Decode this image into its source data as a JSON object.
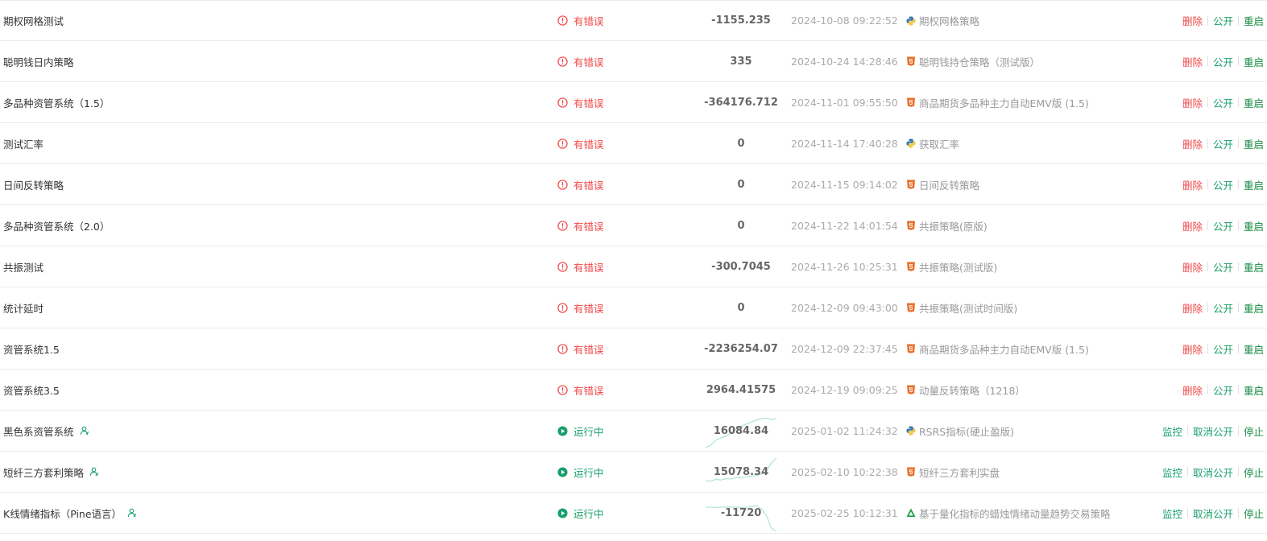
{
  "actions_error": {
    "delete": "删除",
    "publish": "公开",
    "restart": "重启"
  },
  "actions_running": {
    "monitor": "监控",
    "unpublish": "取消公开",
    "stop": "停止"
  },
  "colors": {
    "error": "#f04848",
    "running": "#1aa06c",
    "sparkline": "#9fe0c5"
  },
  "rows": [
    {
      "name": "期权网格测试",
      "status": "有错误",
      "status_type": "error",
      "profit": "-1155.235",
      "time": "2024-10-08 09:22:52",
      "lang": "python-icon",
      "strategy": "期权网格策略",
      "shared": false
    },
    {
      "name": "聪明钱日内策略",
      "status": "有错误",
      "status_type": "error",
      "profit": "335",
      "time": "2024-10-24 14:28:46",
      "lang": "javascript-icon",
      "strategy": "聪明钱持仓策略（测试版）",
      "shared": false
    },
    {
      "name": "多品种资管系统（1.5）",
      "status": "有错误",
      "status_type": "error",
      "profit": "-364176.712",
      "time": "2024-11-01 09:55:50",
      "lang": "javascript-icon",
      "strategy": "商品期货多品种主力自动EMV版 (1.5)",
      "shared": false
    },
    {
      "name": "测试汇率",
      "status": "有错误",
      "status_type": "error",
      "profit": "0",
      "time": "2024-11-14 17:40:28",
      "lang": "python-icon",
      "strategy": "获取汇率",
      "shared": false
    },
    {
      "name": "日间反转策略",
      "status": "有错误",
      "status_type": "error",
      "profit": "0",
      "time": "2024-11-15 09:14:02",
      "lang": "javascript-icon",
      "strategy": "日间反转策略",
      "shared": false
    },
    {
      "name": "多品种资管系统（2.0）",
      "status": "有错误",
      "status_type": "error",
      "profit": "0",
      "time": "2024-11-22 14:01:54",
      "lang": "javascript-icon",
      "strategy": "共振策略(原版)",
      "shared": false
    },
    {
      "name": "共振测试",
      "status": "有错误",
      "status_type": "error",
      "profit": "-300.7045",
      "time": "2024-11-26 10:25:31",
      "lang": "javascript-icon",
      "strategy": "共振策略(测试版)",
      "shared": false
    },
    {
      "name": "统计延时",
      "status": "有错误",
      "status_type": "error",
      "profit": "0",
      "time": "2024-12-09 09:43:00",
      "lang": "javascript-icon",
      "strategy": "共振策略(测试时间版)",
      "shared": false
    },
    {
      "name": "资管系统1.5",
      "status": "有错误",
      "status_type": "error",
      "profit": "-2236254.07",
      "time": "2024-12-09 22:37:45",
      "lang": "javascript-icon",
      "strategy": "商品期货多品种主力自动EMV版 (1.5)",
      "shared": false
    },
    {
      "name": "资管系统3.5",
      "status": "有错误",
      "status_type": "error",
      "profit": "2964.41575",
      "time": "2024-12-19 09:09:25",
      "lang": "javascript-icon",
      "strategy": "动量反转策略（1218）",
      "shared": false
    },
    {
      "name": "黑色系资管系统",
      "status": "运行中",
      "status_type": "running",
      "profit": "16084.84",
      "time": "2025-01-02 11:24:32",
      "lang": "python-icon",
      "strategy": "RSRS指标(硬止盈版)",
      "shared": true,
      "spark": [
        0.05,
        0.12,
        0.28,
        0.35,
        0.4,
        0.5,
        0.62,
        0.7,
        0.78,
        0.84,
        0.9,
        0.95,
        0.97,
        0.92,
        0.96
      ]
    },
    {
      "name": "短纤三方套利策略",
      "status": "运行中",
      "status_type": "running",
      "profit": "15078.34",
      "time": "2025-02-10 10:22:38",
      "lang": "javascript-icon",
      "strategy": "短纤三方套利实盘",
      "shared": true,
      "spark": [
        0.3,
        0.28,
        0.34,
        0.32,
        0.36,
        0.35,
        0.4,
        0.38,
        0.42,
        0.44,
        0.46,
        0.5,
        0.6,
        0.85,
        1.0
      ]
    },
    {
      "name": "K线情绪指标（Pine语言）",
      "status": "运行中",
      "status_type": "running",
      "profit": "-11720",
      "time": "2025-02-25 10:12:31",
      "lang": "pine-icon",
      "strategy": "基于量化指标的蜡烛情绪动量趋势交易策略",
      "shared": true,
      "spark": [
        0.75,
        0.75,
        0.74,
        0.75,
        0.75,
        0.76,
        0.75,
        0.74,
        0.75,
        0.76,
        0.8,
        0.7,
        0.5,
        0.1,
        0.0
      ]
    }
  ]
}
